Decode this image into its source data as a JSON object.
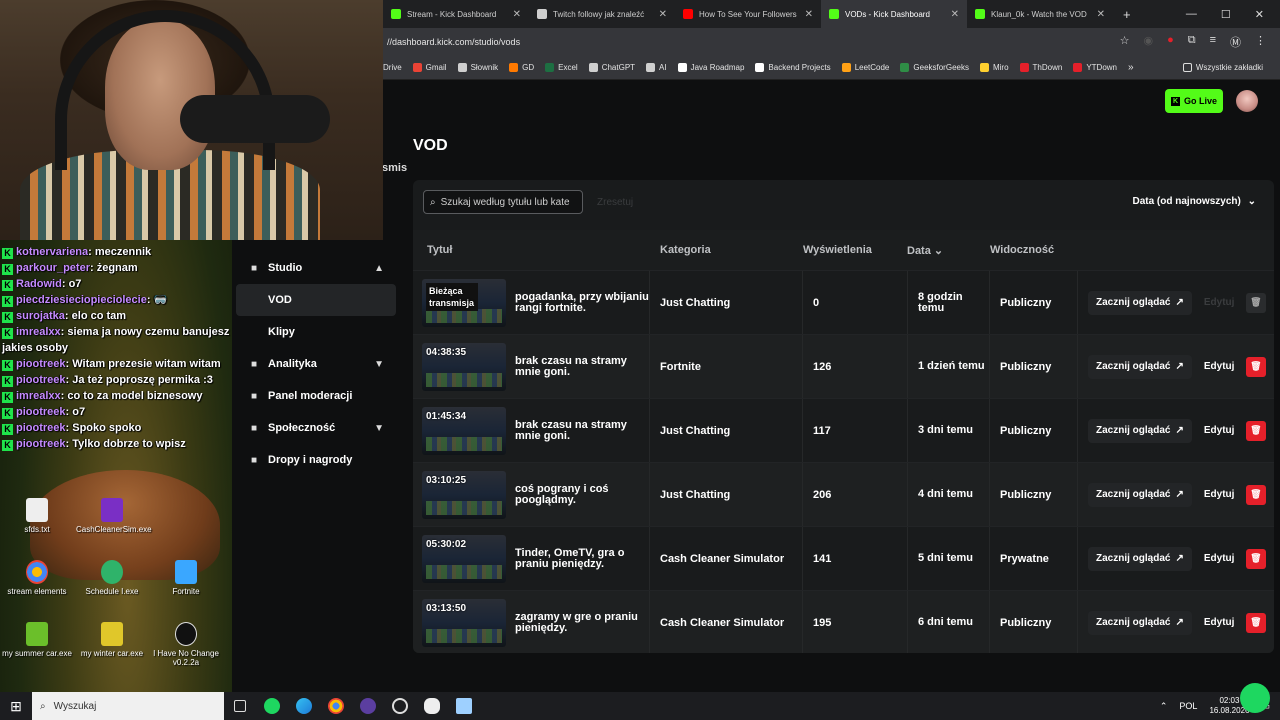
{
  "browser": {
    "tabs": [
      {
        "title": "Stream - Kick Dashboard",
        "active": false,
        "favicon": "kick-icon",
        "color": "#53fc18"
      },
      {
        "title": "Twitch followy jak znaleźć",
        "active": false,
        "favicon": "chatgpt-icon",
        "color": "#cfcfcf"
      },
      {
        "title": "How To See Your Followers",
        "active": false,
        "favicon": "youtube-icon",
        "color": "#ff0000"
      },
      {
        "title": "VODs - Kick Dashboard",
        "active": true,
        "favicon": "kick-icon",
        "color": "#53fc18"
      },
      {
        "title": "Klaun_0k - Watch the VOD",
        "active": false,
        "favicon": "kick-icon",
        "color": "#53fc18"
      }
    ],
    "new_tab": "+",
    "url": "//dashboard.kick.com/studio/vods",
    "bookmarks": [
      {
        "label": "Drive",
        "color": ""
      },
      {
        "label": "Gmail",
        "color": "#ea4335"
      },
      {
        "label": "Słownik",
        "color": "#cfcfcf"
      },
      {
        "label": "GD",
        "color": "#ff7a00"
      },
      {
        "label": "Excel",
        "color": "#1d6f42"
      },
      {
        "label": "ChatGPT",
        "color": "#cfcfcf"
      },
      {
        "label": "AI",
        "color": "#cfcfcf"
      },
      {
        "label": "Java Roadmap",
        "color": "#ffffff"
      },
      {
        "label": "Backend Projects",
        "color": "#ffffff"
      },
      {
        "label": "LeetCode",
        "color": "#ffa116"
      },
      {
        "label": "GeeksforGeeks",
        "color": "#2f8d46"
      },
      {
        "label": "Miro",
        "color": "#ffd02f"
      },
      {
        "label": "ThDown",
        "color": "#e5202a"
      },
      {
        "label": "YTDown",
        "color": "#e5202a"
      }
    ],
    "bookmarks_more": "»",
    "all_bookmarks": "Wszystkie zakładki"
  },
  "chat": [
    {
      "user": "kotnervariena",
      "msg": "meczennik"
    },
    {
      "user": "parkour_peter",
      "msg": "żegnam"
    },
    {
      "user": "Radowid",
      "msg": "o7"
    },
    {
      "user": "piecdziesieciopieciolecie",
      "msg": "🥽"
    },
    {
      "user": "surojatka",
      "msg": "elo co tam"
    },
    {
      "user": "imrealxx",
      "msg": "siema ja nowy czemu banujesz jakies osoby"
    },
    {
      "user": "piootreek",
      "msg": "Witam prezesie witam witam"
    },
    {
      "user": "piootreek",
      "msg": "Ja też poproszę permika :3"
    },
    {
      "user": "imrealxx",
      "msg": "co to za model biznesowy"
    },
    {
      "user": "piootreek",
      "msg": "o7"
    },
    {
      "user": "piootreek",
      "msg": "Spoko spoko"
    },
    {
      "user": "piootreek",
      "msg": "Tylko dobrze to wpisz"
    }
  ],
  "desktop_icons": [
    {
      "label": "sfds.txt"
    },
    {
      "label": "CashCleanerSim.exe"
    },
    {
      "label": "stream elements"
    },
    {
      "label": "Schedule I.exe"
    },
    {
      "label": "Fortnite"
    },
    {
      "label": "my summer car.exe"
    },
    {
      "label": "my winter car.exe"
    },
    {
      "label": "I Have No Change v0.2.2a"
    }
  ],
  "app": {
    "go_live": "Go Live",
    "page_title": "VOD",
    "partial_text": "smis",
    "nav": [
      {
        "label": "Studio",
        "icon": "studio-icon",
        "chevron": "▲",
        "sub": false,
        "active": false
      },
      {
        "label": "VOD",
        "icon": "",
        "chevron": "",
        "sub": true,
        "active": true
      },
      {
        "label": "Klipy",
        "icon": "",
        "chevron": "",
        "sub": true,
        "active": false
      },
      {
        "label": "Analityka",
        "icon": "analytics-icon",
        "chevron": "▼",
        "sub": false,
        "active": false
      },
      {
        "label": "Panel moderacji",
        "icon": "wrench-icon",
        "chevron": "",
        "sub": false,
        "active": false
      },
      {
        "label": "Społeczność",
        "icon": "community-icon",
        "chevron": "▼",
        "sub": false,
        "active": false
      },
      {
        "label": "Dropy i nagrody",
        "icon": "gift-icon",
        "chevron": "",
        "sub": false,
        "active": false
      }
    ],
    "search": {
      "placeholder": "Szukaj według tytułu lub kate",
      "value": ""
    },
    "reset_label": "Zresetuj",
    "sort_label": "Data (od najnowszych)",
    "columns": {
      "title": "Tytuł",
      "category": "Kategoria",
      "views": "Wyświetlenia",
      "date": "Data",
      "visibility": "Widoczność"
    },
    "watch_label": "Zacznij oglądać",
    "edit_label": "Edytuj",
    "rows": [
      {
        "duration": "Bieżąca transmisja",
        "live": true,
        "title": "pogadanka, przy wbijaniu rangi fortnite.",
        "category": "Just Chatting",
        "views": "0",
        "date": "8 godzin temu",
        "visibility": "Publiczny"
      },
      {
        "duration": "04:38:35",
        "live": false,
        "title": "brak czasu na stramy mnie goni.",
        "category": "Fortnite",
        "views": "126",
        "date": "1 dzień temu",
        "visibility": "Publiczny"
      },
      {
        "duration": "01:45:34",
        "live": false,
        "title": "brak czasu na stramy mnie goni.",
        "category": "Just Chatting",
        "views": "117",
        "date": "3 dni temu",
        "visibility": "Publiczny"
      },
      {
        "duration": "03:10:25",
        "live": false,
        "title": "coś pograny i coś pooglądmy.",
        "category": "Just Chatting",
        "views": "206",
        "date": "4 dni temu",
        "visibility": "Publiczny"
      },
      {
        "duration": "05:30:02",
        "live": false,
        "title": "Tinder, OmeTV, gra o praniu pieniędzy.",
        "category": "Cash Cleaner Simulator",
        "views": "141",
        "date": "5 dni temu",
        "visibility": "Prywatne"
      },
      {
        "duration": "03:13:50",
        "live": false,
        "title": "zagramy w gre o praniu pieniędzy.",
        "category": "Cash Cleaner Simulator",
        "views": "195",
        "date": "6 dni temu",
        "visibility": "Publiczny"
      }
    ]
  },
  "taskbar": {
    "search_placeholder": "Wyszukaj",
    "language": "POL",
    "time": "02:03",
    "date": "16.08.2026"
  },
  "colors": {
    "accent": "#53fc18",
    "danger": "#e5202a",
    "chat_user": "#c58bff"
  }
}
